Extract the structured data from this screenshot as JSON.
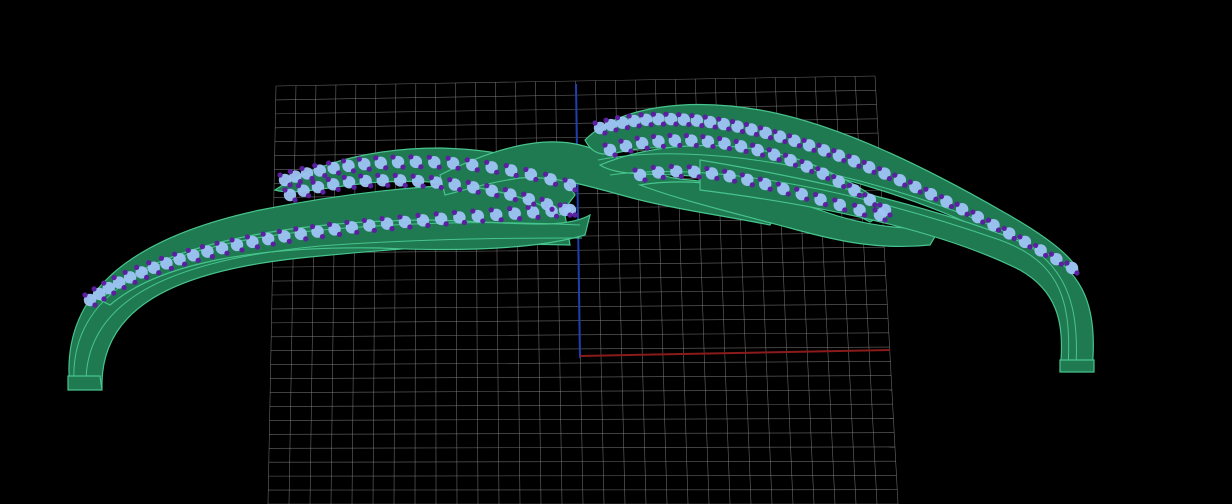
{
  "viewport": {
    "background": "#000000",
    "grid_color": "#8a8a8a",
    "axis_x_color": "#8b1a1a",
    "axis_y_color": "#1f3fb0"
  },
  "model": {
    "band_color": "#1f7a52",
    "band_edge_color": "#47c48c",
    "stone_color": "#9fc4f5",
    "prong_color": "#5b1fa0",
    "stone_rows": 5
  }
}
